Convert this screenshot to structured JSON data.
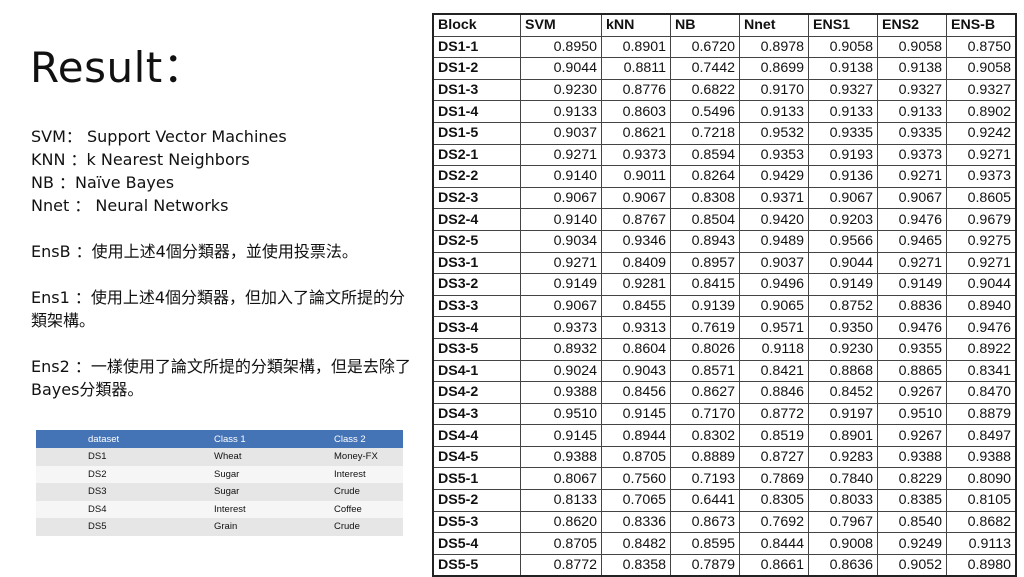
{
  "title": "Result：",
  "definitions": [
    "SVM： Support Vector Machines",
    "KNN ：k Nearest Neighbors",
    "NB ：Naïve Bayes",
    "Nnet ： Neural Networks"
  ],
  "ensemble_notes": [
    "EnsB ：使用上述4個分類器，並使用投票法。",
    "Ens1 ：使用上述4個分類器，但加入了論文所提的分類架構。",
    "Ens2 ：一樣使用了論文所提的分類架構，但是去除了Bayes分類器。"
  ],
  "dataset_table": {
    "headers": [
      "dataset",
      "Class 1",
      "Class 2"
    ],
    "rows": [
      [
        "DS1",
        "Wheat",
        "Money-FX"
      ],
      [
        "DS2",
        "Sugar",
        "Interest"
      ],
      [
        "DS3",
        "Sugar",
        "Crude"
      ],
      [
        "DS4",
        "Interest",
        "Coffee"
      ],
      [
        "DS5",
        "Grain",
        "Crude"
      ]
    ]
  },
  "results_table": {
    "headers": [
      "Block",
      "SVM",
      "kNN",
      "NB",
      "Nnet",
      "ENS1",
      "ENS2",
      "ENS-B"
    ],
    "rows": [
      [
        "DS1-1",
        "0.8950",
        "0.8901",
        "0.6720",
        "0.8978",
        "0.9058",
        "0.9058",
        "0.8750"
      ],
      [
        "DS1-2",
        "0.9044",
        "0.8811",
        "0.7442",
        "0.8699",
        "0.9138",
        "0.9138",
        "0.9058"
      ],
      [
        "DS1-3",
        "0.9230",
        "0.8776",
        "0.6822",
        "0.9170",
        "0.9327",
        "0.9327",
        "0.9327"
      ],
      [
        "DS1-4",
        "0.9133",
        "0.8603",
        "0.5496",
        "0.9133",
        "0.9133",
        "0.9133",
        "0.8902"
      ],
      [
        "DS1-5",
        "0.9037",
        "0.8621",
        "0.7218",
        "0.9532",
        "0.9335",
        "0.9335",
        "0.9242"
      ],
      [
        "DS2-1",
        "0.9271",
        "0.9373",
        "0.8594",
        "0.9353",
        "0.9193",
        "0.9373",
        "0.9271"
      ],
      [
        "DS2-2",
        "0.9140",
        "0.9011",
        "0.8264",
        "0.9429",
        "0.9136",
        "0.9271",
        "0.9373"
      ],
      [
        "DS2-3",
        "0.9067",
        "0.9067",
        "0.8308",
        "0.9371",
        "0.9067",
        "0.9067",
        "0.8605"
      ],
      [
        "DS2-4",
        "0.9140",
        "0.8767",
        "0.8504",
        "0.9420",
        "0.9203",
        "0.9476",
        "0.9679"
      ],
      [
        "DS2-5",
        "0.9034",
        "0.9346",
        "0.8943",
        "0.9489",
        "0.9566",
        "0.9465",
        "0.9275"
      ],
      [
        "DS3-1",
        "0.9271",
        "0.8409",
        "0.8957",
        "0.9037",
        "0.9044",
        "0.9271",
        "0.9271"
      ],
      [
        "DS3-2",
        "0.9149",
        "0.9281",
        "0.8415",
        "0.9496",
        "0.9149",
        "0.9149",
        "0.9044"
      ],
      [
        "DS3-3",
        "0.9067",
        "0.8455",
        "0.9139",
        "0.9065",
        "0.8752",
        "0.8836",
        "0.8940"
      ],
      [
        "DS3-4",
        "0.9373",
        "0.9313",
        "0.7619",
        "0.9571",
        "0.9350",
        "0.9476",
        "0.9476"
      ],
      [
        "DS3-5",
        "0.8932",
        "0.8604",
        "0.8026",
        "0.9118",
        "0.9230",
        "0.9355",
        "0.8922"
      ],
      [
        "DS4-1",
        "0.9024",
        "0.9043",
        "0.8571",
        "0.8421",
        "0.8868",
        "0.8865",
        "0.8341"
      ],
      [
        "DS4-2",
        "0.9388",
        "0.8456",
        "0.8627",
        "0.8846",
        "0.8452",
        "0.9267",
        "0.8470"
      ],
      [
        "DS4-3",
        "0.9510",
        "0.9145",
        "0.7170",
        "0.8772",
        "0.9197",
        "0.9510",
        "0.8879"
      ],
      [
        "DS4-4",
        "0.9145",
        "0.8944",
        "0.8302",
        "0.8519",
        "0.8901",
        "0.9267",
        "0.8497"
      ],
      [
        "DS4-5",
        "0.9388",
        "0.8705",
        "0.8889",
        "0.8727",
        "0.9283",
        "0.9388",
        "0.9388"
      ],
      [
        "DS5-1",
        "0.8067",
        "0.7560",
        "0.7193",
        "0.7869",
        "0.7840",
        "0.8229",
        "0.8090"
      ],
      [
        "DS5-2",
        "0.8133",
        "0.7065",
        "0.6441",
        "0.8305",
        "0.8033",
        "0.8385",
        "0.8105"
      ],
      [
        "DS5-3",
        "0.8620",
        "0.8336",
        "0.8673",
        "0.7692",
        "0.7967",
        "0.8540",
        "0.8682"
      ],
      [
        "DS5-4",
        "0.8705",
        "0.8482",
        "0.8595",
        "0.8444",
        "0.9008",
        "0.9249",
        "0.9113"
      ],
      [
        "DS5-5",
        "0.8772",
        "0.8358",
        "0.7879",
        "0.8661",
        "0.8636",
        "0.9052",
        "0.8980"
      ]
    ]
  }
}
